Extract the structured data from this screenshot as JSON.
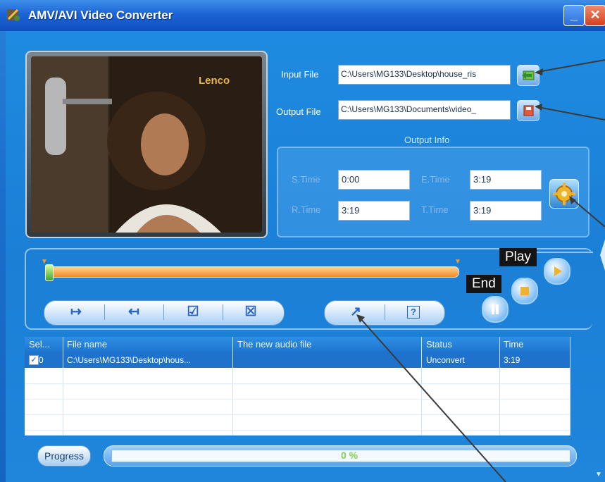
{
  "window": {
    "title": "AMV/AVI Video Converter",
    "min_glyph": "_",
    "close_glyph": "✕"
  },
  "preview": {
    "logo_text": "Lenco"
  },
  "input": {
    "label": "Input File",
    "value": "C:\\Users\\MG133\\Desktop\\house_ris"
  },
  "output": {
    "label": "Output File",
    "value": "C:\\Users\\MG133\\Documents\\video_"
  },
  "output_info": {
    "title": "Output Info",
    "s_time_label": "S.Time",
    "s_time": "0:00",
    "e_time_label": "E.Time",
    "e_time": "3:19",
    "r_time_label": "R.Time",
    "r_time": "3:19",
    "t_time_label": "T.Time",
    "t_time": "3:19"
  },
  "controls": {
    "set_start": "↦",
    "set_end": "↤",
    "select_all": "☑",
    "deselect": "☒",
    "convert": "↗",
    "help": "?"
  },
  "playback": {
    "play_tag": "Play",
    "end_tag": "End"
  },
  "table": {
    "headers": [
      "Sel...",
      "File name",
      "The new audio file",
      "Status",
      "Time"
    ],
    "rows": [
      {
        "sel": "0",
        "file": "C:\\Users\\MG133\\Desktop\\hous...",
        "new": "",
        "status": "Unconvert",
        "time": "3:19"
      }
    ]
  },
  "progress": {
    "label": "Progress",
    "text": "0 %",
    "value": 0
  },
  "colors": {
    "accent": "#1f72cc",
    "title_bar": "#1c64d6",
    "progress_text": "#7fd34a"
  }
}
